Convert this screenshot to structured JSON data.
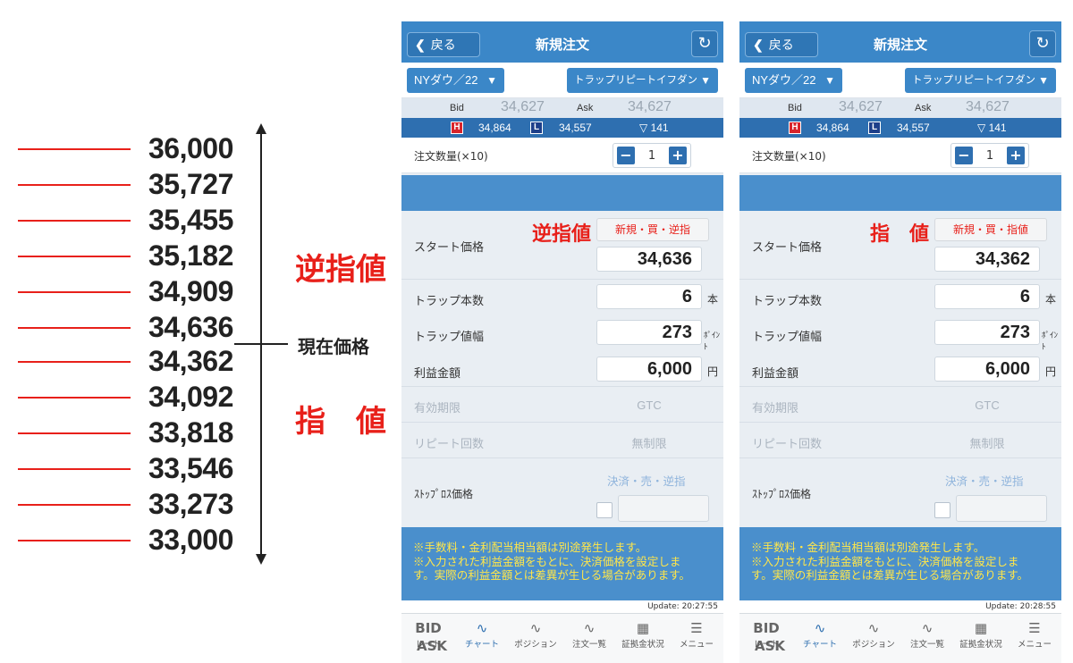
{
  "diagram": {
    "levels": [
      "36,000",
      "35,727",
      "35,455",
      "35,182",
      "34,909",
      "34,636",
      "34,362",
      "34,092",
      "33,818",
      "33,546",
      "33,273",
      "33,000"
    ],
    "current_price_label": "現在価格",
    "stop_label": "逆指値",
    "limit_label": "指　値",
    "colors": {
      "accent": "#e8201a",
      "text": "#222222"
    }
  },
  "panels": [
    {
      "nav": {
        "back": "戻る",
        "title": "新規注文"
      },
      "symbol": "NYダウ／22",
      "order_kind": "トラップリピートイフダン",
      "bid_label": "Bid",
      "bid": "34,627",
      "ask_label": "Ask",
      "ask": "34,627",
      "high_badge": "H",
      "high": "34,864",
      "low_badge": "L",
      "low": "34,557",
      "change": "▽ 141",
      "qty_label": "注文数量(×10)",
      "qty": "1",
      "order_tag": "逆指値",
      "order_type": "新規・買・逆指",
      "start_label": "スタート価格",
      "start_price": "34,636",
      "trap_count_label": "トラップ本数",
      "trap_count": "6",
      "trap_count_unit": "本",
      "trap_width_label": "トラップ値幅",
      "trap_width": "273",
      "trap_width_unit": "ﾎﾟｲﾝﾄ",
      "profit_label": "利益金額",
      "profit": "6,000",
      "profit_unit": "円",
      "expiry_label": "有効期限",
      "expiry": "GTC",
      "repeat_label": "リピート回数",
      "repeat": "無制限",
      "stoploss_label": "ｽﾄｯﾌﾟﾛｽ価格",
      "stoploss_type": "決済・売・逆指",
      "notes": [
        "※手数料・金利配当相当額は別途発生します。",
        "※入力された利益金額をもとに、決済価格を設定しま",
        "す。実際の利益金額とは差異が生じる場合があります。"
      ],
      "update": "Update: 20:27:55"
    },
    {
      "nav": {
        "back": "戻る",
        "title": "新規注文"
      },
      "symbol": "NYダウ／22",
      "order_kind": "トラップリピートイフダン",
      "bid_label": "Bid",
      "bid": "34,627",
      "ask_label": "Ask",
      "ask": "34,627",
      "high_badge": "H",
      "high": "34,864",
      "low_badge": "L",
      "low": "34,557",
      "change": "▽ 141",
      "qty_label": "注文数量(×10)",
      "qty": "1",
      "order_tag": "指　値",
      "order_type": "新規・買・指値",
      "start_label": "スタート価格",
      "start_price": "34,362",
      "trap_count_label": "トラップ本数",
      "trap_count": "6",
      "trap_count_unit": "本",
      "trap_width_label": "トラップ値幅",
      "trap_width": "273",
      "trap_width_unit": "ﾎﾟｲﾝﾄ",
      "profit_label": "利益金額",
      "profit": "6,000",
      "profit_unit": "円",
      "expiry_label": "有効期限",
      "expiry": "GTC",
      "repeat_label": "リピート回数",
      "repeat": "無制限",
      "stoploss_label": "ｽﾄｯﾌﾟﾛｽ価格",
      "stoploss_type": "決済・売・逆指",
      "notes": [
        "※手数料・金利配当相当額は別途発生します。",
        "※入力された利益金額をもとに、決済価格を設定しま",
        "す。実際の利益金額とは差異が生じる場合があります。"
      ],
      "update": "Update: 20:28:55"
    }
  ],
  "tabbar": {
    "rate_icon_top": "BID",
    "rate_icon_bottom": "ASK",
    "items": [
      "レート",
      "チャート",
      "ポジション",
      "注文一覧",
      "証拠金状況",
      "メニュー"
    ],
    "active": "チャート"
  }
}
